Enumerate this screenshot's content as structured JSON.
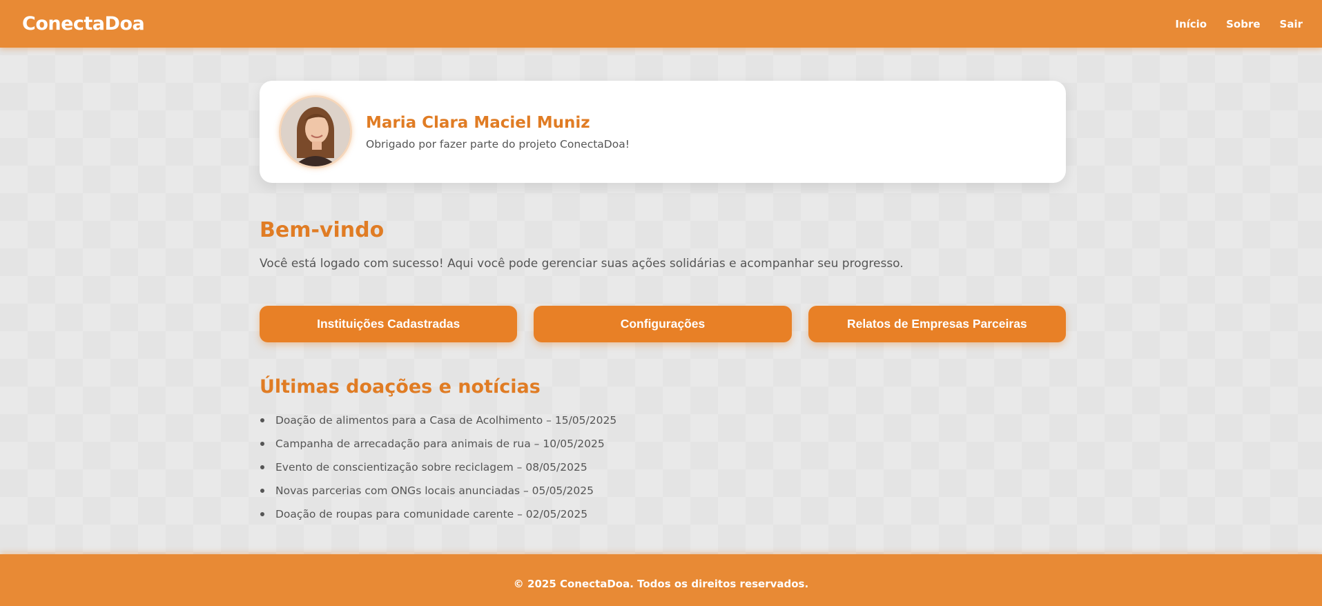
{
  "header": {
    "brand": "ConectaDoa",
    "nav": [
      {
        "label": "Início"
      },
      {
        "label": "Sobre"
      },
      {
        "label": "Sair"
      }
    ]
  },
  "profile": {
    "name": "Maria Clara Maciel Muniz",
    "subtitle": "Obrigado por fazer parte do projeto ConectaDoa!"
  },
  "welcome": {
    "title": "Bem-vindo",
    "text": "Você está logado com sucesso! Aqui você pode gerenciar suas ações solidárias e acompanhar seu progresso."
  },
  "actions": [
    {
      "label": "Instituições Cadastradas"
    },
    {
      "label": "Configurações"
    },
    {
      "label": "Relatos de Empresas Parceiras"
    }
  ],
  "news": {
    "title": "Últimas doações e notícias",
    "items": [
      "Doação de alimentos para a Casa de Acolhimento – 15/05/2025",
      "Campanha de arrecadação para animais de rua – 10/05/2025",
      "Evento de conscientização sobre reciclagem – 08/05/2025",
      "Novas parcerias com ONGs locais anunciadas – 05/05/2025",
      "Doação de roupas para comunidade carente – 02/05/2025"
    ]
  },
  "footer": {
    "text": "© 2025 ConectaDoa. Todos os direitos reservados."
  },
  "colors": {
    "brand_orange": "#e88a35",
    "heading_orange": "#e07c24",
    "button_orange": "#e88026"
  }
}
